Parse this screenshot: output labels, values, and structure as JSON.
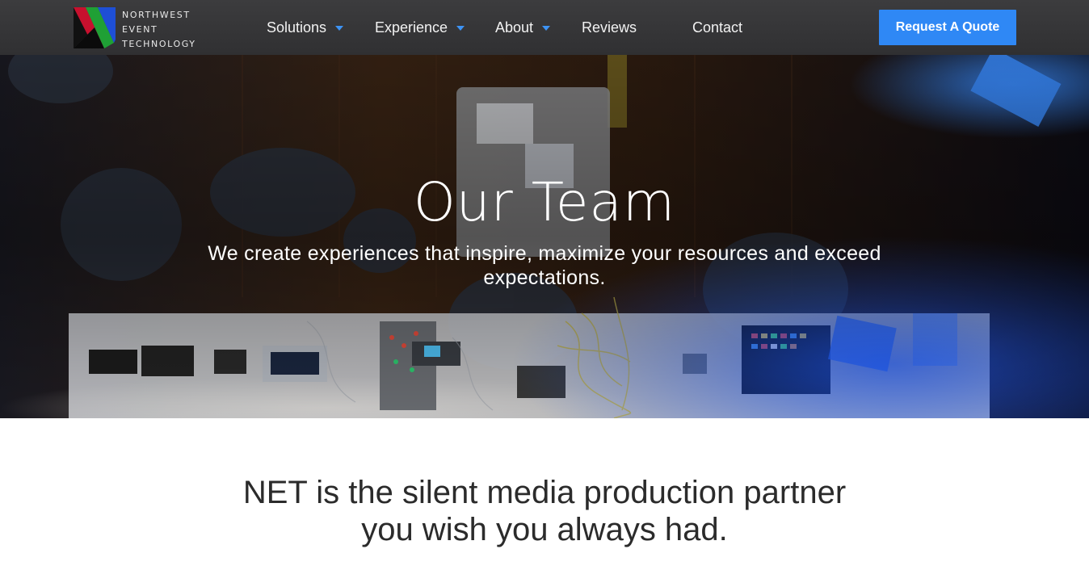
{
  "brand": {
    "name_lines": [
      "NORTHWEST",
      "EVENT",
      "TECHNOLOGY"
    ],
    "logo_colors": [
      "#c8102e",
      "#1fa035",
      "#1e4fd6",
      "#111111"
    ]
  },
  "nav": {
    "items": [
      {
        "label": "Solutions",
        "has_dropdown": true
      },
      {
        "label": "Experience",
        "has_dropdown": true
      },
      {
        "label": "About",
        "has_dropdown": true
      },
      {
        "label": "Reviews",
        "has_dropdown": false
      },
      {
        "label": "Contact",
        "has_dropdown": false
      }
    ],
    "cta_label": "Request A Quote"
  },
  "hero": {
    "title": "Our Team",
    "subtitle": "We create experiences that inspire, maximize your resources and exceed expectations."
  },
  "intro": {
    "heading_line1": "NET is the silent media production partner",
    "heading_line2": "you wish you always had."
  },
  "colors": {
    "header_bg": "#353537",
    "accent": "#2f88f5",
    "text_dark": "#2b2b2b"
  }
}
